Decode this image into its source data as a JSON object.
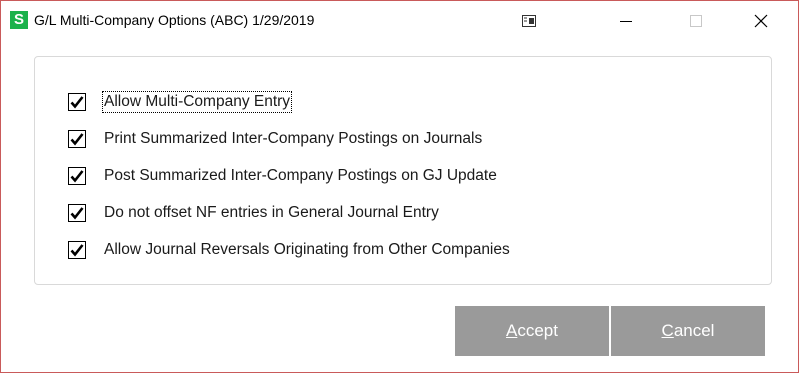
{
  "window": {
    "title": "G/L Multi-Company Options (ABC) 1/29/2019",
    "app_icon_letter": "S",
    "icons": {
      "app": "sage-s-icon",
      "restore": "window-snap-icon",
      "minimize": "minimize-icon",
      "maximize": "maximize-icon",
      "close": "close-icon"
    }
  },
  "options": [
    {
      "label": "Allow Multi-Company Entry",
      "checked": true
    },
    {
      "label": "Print Summarized Inter-Company Postings on Journals",
      "checked": true
    },
    {
      "label": "Post Summarized Inter-Company Postings on GJ Update",
      "checked": true
    },
    {
      "label": "Do not offset NF entries in General Journal Entry",
      "checked": true
    },
    {
      "label": "Allow Journal Reversals Originating from Other Companies",
      "checked": true
    }
  ],
  "buttons": {
    "accept_hotkey": "A",
    "accept_rest": "ccept",
    "cancel_hotkey": "C",
    "cancel_rest": "ancel"
  },
  "colors": {
    "window_border": "#c95a5a",
    "app_icon": "#1bb24b",
    "button_bg": "#9a9a9a",
    "button_text": "#ffffff"
  }
}
